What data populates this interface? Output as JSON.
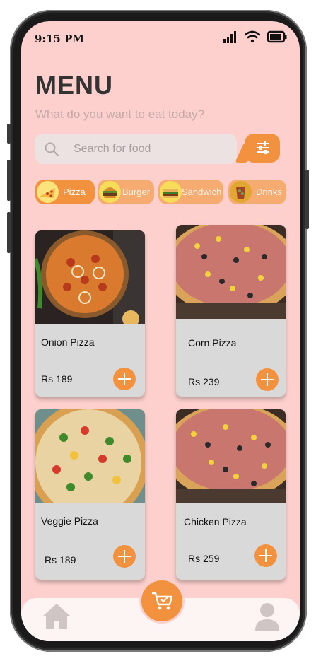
{
  "status": {
    "time": "9:15 PM"
  },
  "header": {
    "title": "MENU",
    "subtitle": "What do you want to eat today?"
  },
  "search": {
    "placeholder": "Search for food"
  },
  "categories": [
    {
      "label": "Pizza",
      "icon": "pizza-icon",
      "active": true
    },
    {
      "label": "Burger",
      "icon": "burger-icon",
      "active": false
    },
    {
      "label": "Sandwich",
      "icon": "sandwich-icon",
      "active": false
    },
    {
      "label": "Drinks",
      "icon": "drinks-icon",
      "active": false
    }
  ],
  "items": [
    {
      "name": "Onion Pizza",
      "price": "Rs 189"
    },
    {
      "name": "Corn Pizza",
      "price": "Rs 239"
    },
    {
      "name": "Veggie Pizza",
      "price": "Rs 189"
    },
    {
      "name": "Chicken Pizza",
      "price": "Rs 259"
    }
  ],
  "theme": {
    "accent": "#f2923e",
    "background": "#fdd0cd",
    "card": "#d9d9d9"
  },
  "nav": [
    "home-icon",
    "cart-icon",
    "profile-icon"
  ]
}
